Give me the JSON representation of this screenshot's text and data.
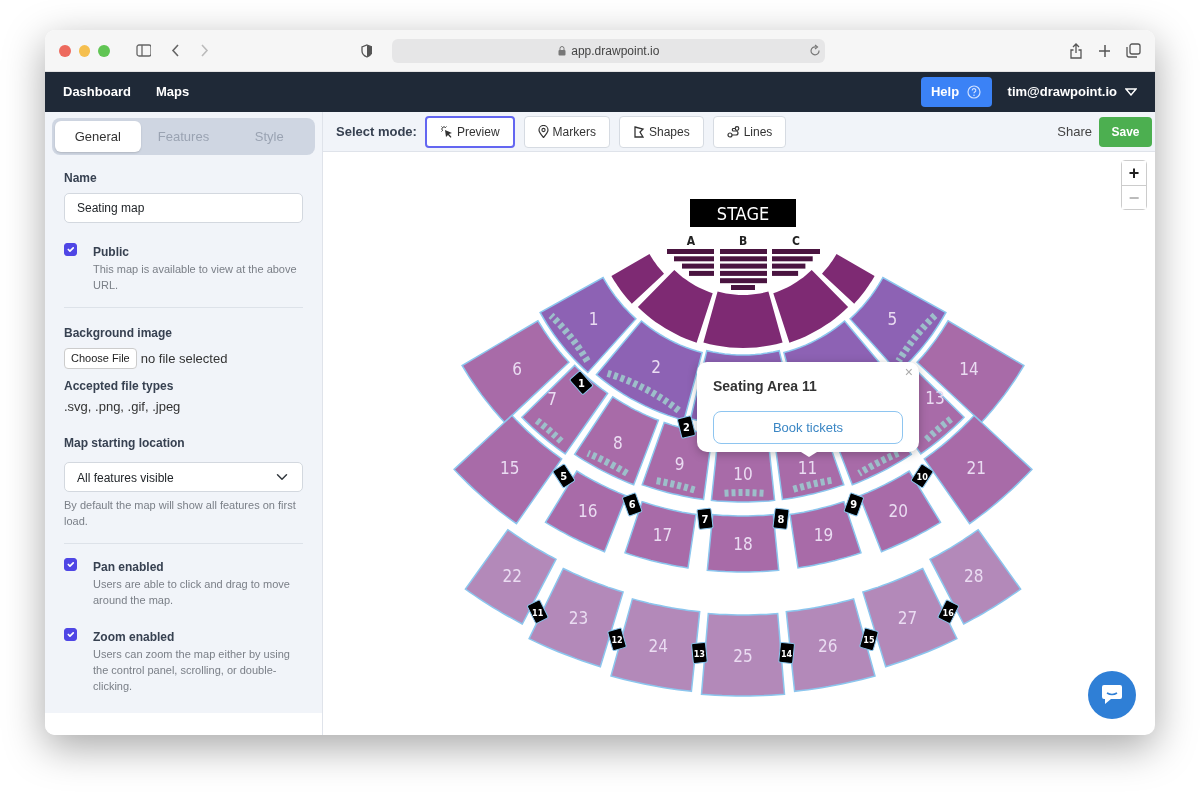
{
  "browser": {
    "url": "app.drawpoint.io"
  },
  "navbar": {
    "links": [
      {
        "label": "Dashboard"
      },
      {
        "label": "Maps"
      }
    ],
    "help": "Help",
    "user": "tim@drawpoint.io"
  },
  "sidebar": {
    "tabs": [
      {
        "label": "General",
        "selected": true
      },
      {
        "label": "Features",
        "selected": false
      },
      {
        "label": "Style",
        "selected": false
      }
    ],
    "name_field": {
      "label": "Name",
      "value": "Seating map"
    },
    "public": {
      "label": "Public",
      "checked": true,
      "help": "This map is available to view at the above URL."
    },
    "background_image": {
      "label": "Background image",
      "button": "Choose File",
      "status": "no file selected",
      "accepted_label": "Accepted file types",
      "accepted": ".svg, .png, .gif, .jpeg"
    },
    "starting_location": {
      "label": "Map starting location",
      "value": "All features visible",
      "help": "By default the map will show all features on first load."
    },
    "pan": {
      "label": "Pan enabled",
      "checked": true,
      "help": "Users are able to click and drag to move around the map."
    },
    "zoom": {
      "label": "Zoom enabled",
      "checked": true,
      "help": "Users can zoom the map either by using the control panel, scrolling, or double-clicking."
    }
  },
  "toolbar": {
    "label": "Select mode:",
    "modes": [
      {
        "label": "Preview",
        "kind": "preview",
        "selected": true
      },
      {
        "label": "Markers",
        "kind": "markers",
        "selected": false
      },
      {
        "label": "Shapes",
        "kind": "shapes",
        "selected": false
      },
      {
        "label": "Lines",
        "kind": "lines",
        "selected": false
      }
    ],
    "share": "Share",
    "save": "Save"
  },
  "map": {
    "zoom_controls": [
      {
        "label": "+",
        "disabled": false
      },
      {
        "label": "−",
        "disabled": true
      }
    ],
    "stage": "STAGE",
    "rows": [
      "A",
      "B",
      "C"
    ],
    "sections": [
      "1",
      "2",
      "5",
      "6",
      "7",
      "8",
      "9",
      "10",
      "11",
      "13",
      "14",
      "15",
      "16",
      "17",
      "18",
      "19",
      "20",
      "21",
      "22",
      "23",
      "24",
      "25",
      "26",
      "27",
      "28"
    ],
    "gates": [
      "1",
      "2",
      "5",
      "6",
      "7",
      "8",
      "9",
      "10",
      "11",
      "12",
      "13",
      "14",
      "15",
      "16"
    ],
    "popup": {
      "title": "Seating Area 11",
      "close": "×",
      "button": "Book tickets"
    }
  }
}
